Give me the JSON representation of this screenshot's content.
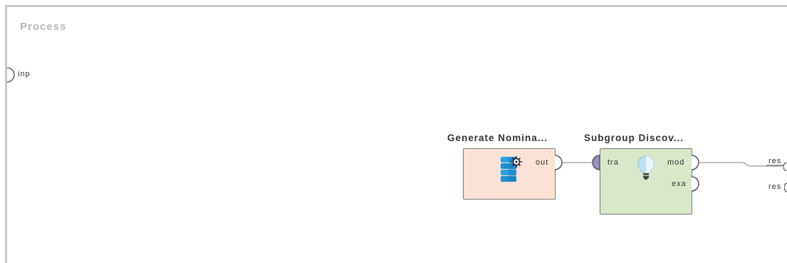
{
  "process": {
    "title": "Process",
    "input_port_label": "inp",
    "output_ports": [
      "res",
      "res"
    ]
  },
  "operators": {
    "generate": {
      "title": "Generate Nomina...",
      "icon": "database-gear-icon",
      "output_port": "out",
      "color": "#fbe2d6"
    },
    "subgroup": {
      "title": "Subgroup Discov...",
      "icon": "lightbulb-icon",
      "input_port": "tra",
      "output_ports": [
        "mod",
        "exa"
      ],
      "color": "#d9e8c9"
    }
  },
  "colors": {
    "frame": "#c8c8c8",
    "wire": "#a8a8a8",
    "input_port_fill": "#9c8fc8",
    "database_blue": "#2b9fe0"
  }
}
